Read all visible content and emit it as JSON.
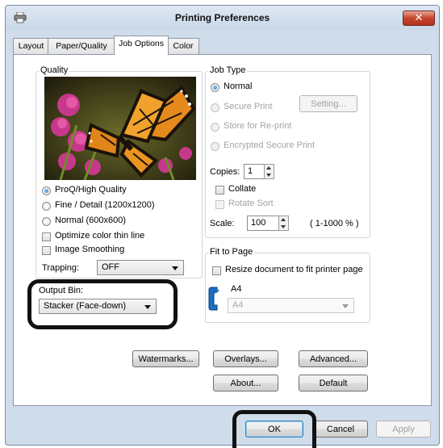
{
  "window": {
    "title": "Printing Preferences",
    "close_glyph": "✕"
  },
  "tabs": [
    {
      "label": "Layout",
      "active": false
    },
    {
      "label": "Paper/Quality",
      "active": false
    },
    {
      "label": "Job Options",
      "active": true
    },
    {
      "label": "Color",
      "active": false
    }
  ],
  "quality": {
    "legend": "Quality",
    "options": [
      {
        "label": "ProQ/High Quality",
        "selected": true
      },
      {
        "label": "Fine / Detail (1200x1200)",
        "selected": false
      },
      {
        "label": "Normal (600x600)",
        "selected": false
      }
    ],
    "optimize_color_thin_line": "Optimize color thin line",
    "image_smoothing": "Image Smoothing",
    "trapping_label": "Trapping:",
    "trapping_value": "OFF"
  },
  "output_bin": {
    "label": "Output Bin:",
    "value": "Stacker (Face-down)"
  },
  "job_type": {
    "legend": "Job Type",
    "normal": "Normal",
    "secure_print": "Secure Print",
    "setting_button": "Setting...",
    "store_for_reprint": "Store for Re-print",
    "encrypted_secure_print": "Encrypted Secure Print",
    "copies_label": "Copies:",
    "copies_value": "1",
    "collate": "Collate",
    "rotate_sort": "Rotate Sort",
    "scale_label": "Scale:",
    "scale_value": "100",
    "scale_range": "( 1-1000 % )"
  },
  "fit_to_page": {
    "legend": "Fit to Page",
    "resize_label": "Resize document to fit printer page",
    "paper_size_label": "A4",
    "paper_size_value": "A4"
  },
  "buttons": {
    "watermarks": "Watermarks...",
    "overlays": "Overlays...",
    "advanced": "Advanced...",
    "about": "About...",
    "default": "Default",
    "ok": "OK",
    "cancel": "Cancel",
    "apply": "Apply"
  },
  "colors": {
    "window_bg": "#cfdcea",
    "close_red": "#c7442d",
    "radio_selected": "#1a6fc4",
    "highlight_outline": "#111111"
  },
  "icons": [
    "printer-icon",
    "close-icon",
    "butterfly-preview-image",
    "portrait-orientation-icon",
    "dropdown-arrow-icon",
    "spinner-icon"
  ]
}
